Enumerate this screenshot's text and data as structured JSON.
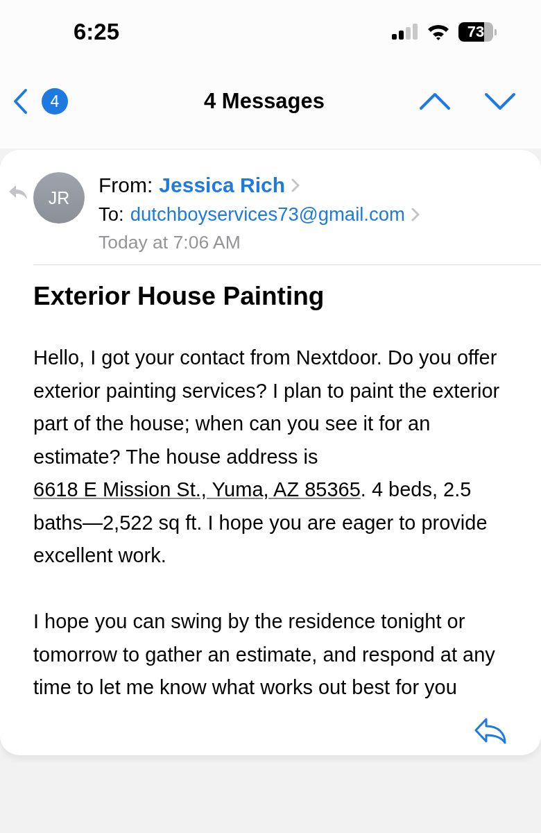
{
  "status_bar": {
    "time": "6:25",
    "battery": "73"
  },
  "nav": {
    "back_badge": "4",
    "title": "4 Messages"
  },
  "message": {
    "avatar": "JR",
    "replied": true,
    "from_label": "From:",
    "from_name": "Jessica Rich",
    "to_label": "To:",
    "to_address": "dutchboyservices73@gmail.com",
    "date": "Today at 7:06 AM",
    "subject": "Exterior House Painting",
    "paragraphs": [
      [
        {
          "kind": "text",
          "text": "Hello, I got your contact from Nextdoor. Do you offer exterior painting services? I plan to paint the exterior part of the house; when can you see it for an estimate? The house address is "
        },
        {
          "kind": "link",
          "text": "6618 E Mission St., Yuma, AZ 85365"
        },
        {
          "kind": "text",
          "text": ". 4 beds, 2.5 baths—2,522 sq ft. I hope you are eager to provide excellent work."
        }
      ],
      [
        {
          "kind": "text",
          "text": "I hope you can swing by the residence tonight or tomorrow to gather an estimate, and respond at any time to let me know what works out best for you"
        }
      ]
    ]
  }
}
